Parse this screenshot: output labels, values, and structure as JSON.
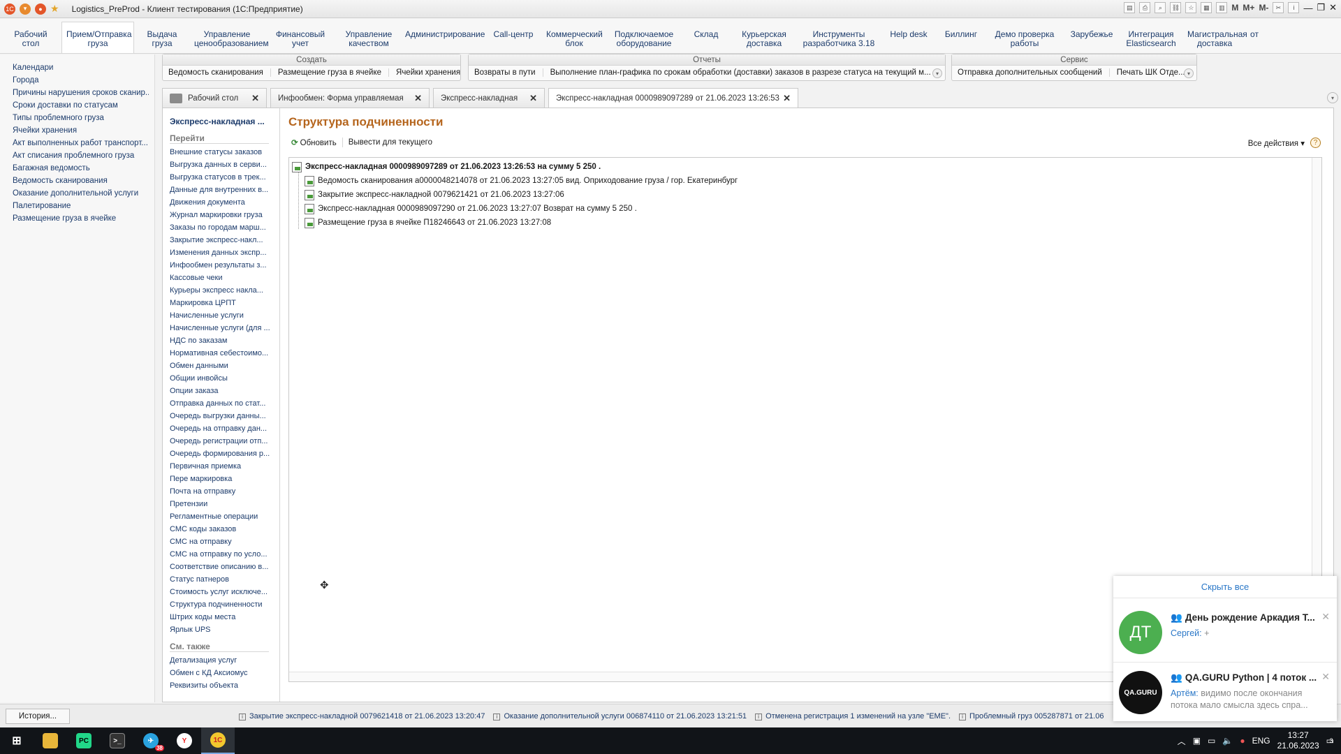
{
  "window": {
    "title": "Logistics_PreProd - Клиент тестирования (1С:Предприятие)"
  },
  "sections": [
    {
      "label": "Рабочий\nстол"
    },
    {
      "label": "Прием/Отправка\nгруза",
      "active": true
    },
    {
      "label": "Выдача\nгруза"
    },
    {
      "label": "Управление\nценообразованием"
    },
    {
      "label": "Финансовый\nучет"
    },
    {
      "label": "Управление\nкачеством"
    },
    {
      "label": "Администрирование"
    },
    {
      "label": "Call-центр"
    },
    {
      "label": "Коммерческий\nблок"
    },
    {
      "label": "Подключаемое\nоборудование"
    },
    {
      "label": "Склад"
    },
    {
      "label": "Курьерская\nдоставка"
    },
    {
      "label": "Инструменты\nразработчика 3.18"
    },
    {
      "label": "Help desk"
    },
    {
      "label": "Биллинг"
    },
    {
      "label": "Демо проверка\nработы"
    },
    {
      "label": "Зарубежье"
    },
    {
      "label": "Интеграция\nElasticsearch"
    },
    {
      "label": "Магистральная\nдоставка"
    },
    {
      "label": "от"
    }
  ],
  "leftnav": [
    "Календари",
    "Города",
    "Причины нарушения сроков сканир...",
    "Сроки доставки по статусам",
    "Типы проблемного груза",
    "Ячейки хранения",
    "Акт выполненных работ транспорт...",
    "Акт списания проблемного груза",
    "Багажная ведомость",
    "Ведомость сканирования",
    "Оказание дополнительной услуги",
    "Палетирование",
    "Размещение груза в ячейке"
  ],
  "groups": {
    "create": {
      "title": "Создать",
      "items": [
        "Ведомость сканирования",
        "Размещение груза в ячейке",
        "Ячейки хранения"
      ]
    },
    "reports": {
      "title": "Отчеты",
      "items": [
        "Возвраты в пути",
        "Выполнение план-графика по срокам обработки (доставки) заказов в разрезе статуса  на текущий м..."
      ]
    },
    "service": {
      "title": "Сервис",
      "items": [
        "Отправка дополнительных сообщений",
        "Печать ШК Отде..."
      ]
    }
  },
  "tabs": [
    {
      "label": "Рабочий стол",
      "home": true
    },
    {
      "label": "Инфообмен: Форма управляемая"
    },
    {
      "label": "Экспресс-накладная"
    },
    {
      "label": "Экспресс-накладная 0000989097289 от 21.06.2023 13:26:53",
      "active": true
    }
  ],
  "panel": {
    "title": "Экспресс-накладная ...",
    "goto_header": "Перейти",
    "goto_items": [
      "Внешние статусы заказов",
      "Выгрузка данных в серви...",
      "Выгрузка статусов в трек...",
      "Данные для внутренних в...",
      "Движения документа",
      "Журнал маркировки груза",
      "Заказы по городам марш...",
      "Закрытие экспресс-накл...",
      "Изменения данных экспр...",
      "Инфообмен результаты з...",
      "Кассовые чеки",
      "Курьеры экспресс накла...",
      "Маркировка ЦРПТ",
      "Начисленные услуги",
      "Начисленные услуги (для ...",
      "НДС по заказам",
      "Нормативная себестоимо...",
      "Обмен данными",
      "Общии инвойсы",
      "Опции заказа",
      "Отправка данных по стат...",
      "Очередь выгрузки данны...",
      "Очередь на отправку дан...",
      "Очередь регистрации отп...",
      "Очередь формирования р...",
      "Первичная приемка",
      "Пере маркировка",
      "Почта на отправку",
      "Претензии",
      "Регламентные операции",
      "СМС коды заказов",
      "СМС на отправку",
      "СМС на отправку по усло...",
      "Соответствие описанию в...",
      "Статус патнеров",
      "Стоимость услуг исключе...",
      "Структура подчиненности",
      "Штрих коды места",
      "Ярлык UPS"
    ],
    "seealso_header": "См. также",
    "seealso_items": [
      "Детализация услуг",
      "Обмен с КД Аксиомус",
      "Реквизиты объекта"
    ]
  },
  "content": {
    "title": "Структура подчиненности",
    "refresh": "Обновить",
    "show_current": "Вывести для текущего",
    "all_actions": "Все действия",
    "tree_root": "Экспресс-накладная 0000989097289 от 21.06.2023 13:26:53 на сумму 5 250 .",
    "tree_children": [
      "Ведомость сканирования а0000048214078 от 21.06.2023 13:27:05  вид. Оприходование груза / гор. Екатеринбург",
      "Закрытие экспресс-накладной 0079621421 от 21.06.2023 13:27:06",
      "Экспресс-накладная 0000989097290 от 21.06.2023 13:27:07  Возврат на сумму 5 250 .",
      "Размещение груза в ячейке П18246643 от 21.06.2023 13:27:08"
    ]
  },
  "statusbar": {
    "history": "История...",
    "notes": [
      "Закрытие экспресс-накладной 0079621418 от 21.06.2023 13:20:47",
      "Оказание дополнительной услуги 006874110 от 21.06.2023 13:21:51",
      "Отменена регистрация 1 изменений  на узле \"EME\".",
      "Проблемный груз 005287871 от 21.06"
    ]
  },
  "notifications": {
    "hide_all": "Скрыть все",
    "items": [
      {
        "avatar": "ДТ",
        "title": "День рождение Аркадия Т...",
        "sender": "Сергей:",
        "text": " +",
        "color": "#4caf50"
      },
      {
        "avatar": "QA.GURU",
        "title": "QA.GURU Python | 4 поток ...",
        "sender": "Артём:",
        "text": " видимо после окончания потока мало смысла здесь спра...",
        "color": "#111111"
      }
    ]
  },
  "taskbar": {
    "lang": "ENG",
    "time": "13:27",
    "date": "21.06.2023",
    "telegram_badge": "38",
    "notif_count": "3"
  }
}
